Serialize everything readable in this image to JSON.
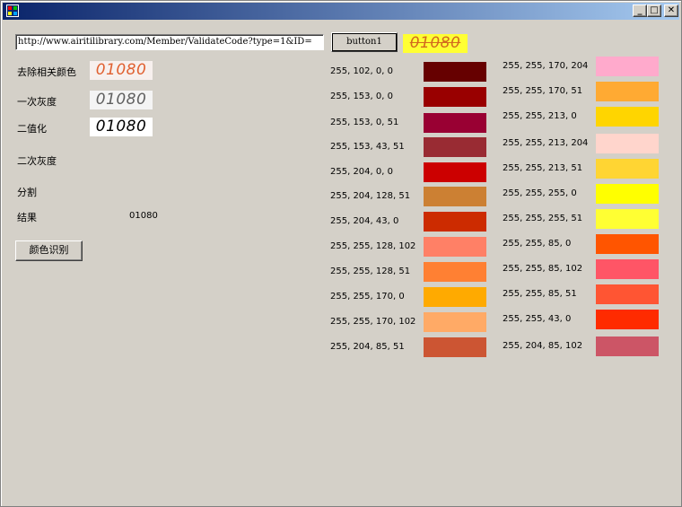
{
  "window": {
    "controls": {
      "minimize": "_",
      "maximize": "□",
      "close": "✕"
    }
  },
  "toolbar": {
    "url_value": "http://www.airitilibrary.com/Member/ValidateCode?type=1&ID=",
    "button1_label": "button1",
    "captcha_text": "01080"
  },
  "steps": [
    {
      "label": "去除相关颜色",
      "captcha": "01080"
    },
    {
      "label": "一次灰度",
      "captcha": "01080"
    },
    {
      "label": "二值化",
      "captcha": "01080"
    },
    {
      "label": "二次灰度"
    },
    {
      "label": "分割"
    },
    {
      "label": "结果",
      "value": "01080"
    }
  ],
  "recognize_button_label": "颜色识别",
  "palette_left": [
    {
      "label": "255, 102, 0, 0",
      "color": "#660000"
    },
    {
      "label": "255, 153, 0, 0",
      "color": "#990000"
    },
    {
      "label": "255, 153, 0, 51",
      "color": "#990033"
    },
    {
      "label": "255, 153, 43, 51",
      "color": "#992b33"
    },
    {
      "label": "255, 204, 0, 0",
      "color": "#cc0000"
    },
    {
      "label": "255, 204, 128, 51",
      "color": "#cc8033"
    },
    {
      "label": "255, 204, 43, 0",
      "color": "#cc2b00"
    },
    {
      "label": "255, 255, 128, 102",
      "color": "#ff8066"
    },
    {
      "label": "255, 255, 128, 51",
      "color": "#ff8033"
    },
    {
      "label": "255, 255, 170, 0",
      "color": "#ffaa00"
    },
    {
      "label": "255, 255, 170, 102",
      "color": "#ffaa66"
    },
    {
      "label": "255, 204, 85, 51",
      "color": "#cc5533"
    }
  ],
  "palette_right": [
    {
      "label": "255, 255, 170, 204",
      "color": "#ffaacc"
    },
    {
      "label": "255, 255, 170, 51",
      "color": "#ffaa33"
    },
    {
      "label": "255, 255, 213, 0",
      "color": "#ffd500"
    },
    {
      "label": "255, 255, 213, 204",
      "color": "#ffd5cc"
    },
    {
      "label": "255, 255, 213, 51",
      "color": "#ffd533"
    },
    {
      "label": "255, 255, 255, 0",
      "color": "#ffff00"
    },
    {
      "label": "255, 255, 255, 51",
      "color": "#ffff33"
    },
    {
      "label": "255, 255, 85, 0",
      "color": "#ff5500"
    },
    {
      "label": "255, 255, 85, 102",
      "color": "#ff5566"
    },
    {
      "label": "255, 255, 85, 51",
      "color": "#ff5533"
    },
    {
      "label": "255, 255, 43, 0",
      "color": "#ff2b00"
    },
    {
      "label": "255, 204, 85, 102",
      "color": "#cc5566"
    }
  ]
}
